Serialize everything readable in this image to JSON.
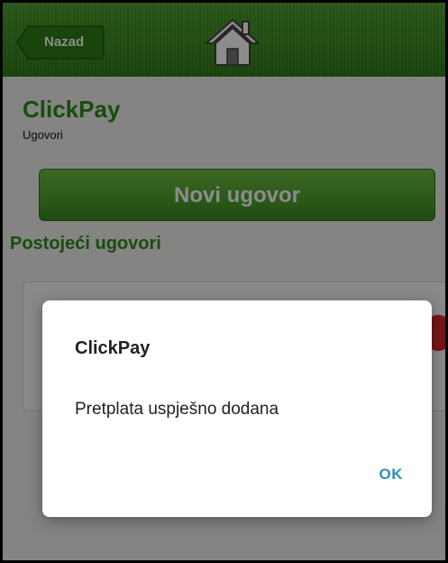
{
  "header": {
    "back_label": "Nazad",
    "home_icon": "home-icon"
  },
  "app": {
    "title": "ClickPay",
    "subtitle": "Ugovori"
  },
  "main": {
    "new_contract_label": "Novi ugovor",
    "existing_title": "Postojeći ugovori"
  },
  "dialog": {
    "title": "ClickPay",
    "message": "Pretplata uspješno dodana",
    "ok_label": "OK"
  },
  "colors": {
    "brand_green": "#2e8a1a",
    "dialog_accent": "#2f8fb7"
  }
}
